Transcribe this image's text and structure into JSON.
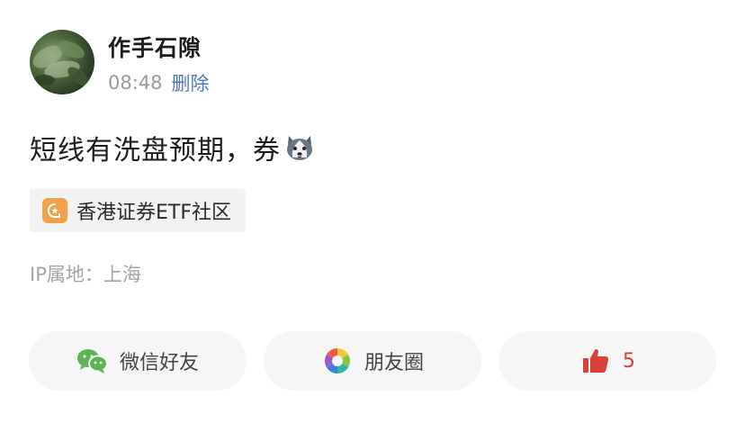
{
  "post": {
    "username": "作手石隙",
    "time": "08:48",
    "delete_label": "删除",
    "content_text": "短线有洗盘预期，券",
    "emoji_icon": "husky-dog-emoji",
    "community": {
      "icon": "community-badge-icon",
      "label": "香港证券ETF社区"
    },
    "ip_location": "IP属地：上海"
  },
  "actions": {
    "wechat_label": "微信好友",
    "moments_label": "朋友圈",
    "like_count": "5"
  },
  "colors": {
    "link_blue": "#5277b9",
    "like_red": "#d9403a",
    "community_orange": "#f0a14a",
    "wechat_green": "#5ab552"
  }
}
